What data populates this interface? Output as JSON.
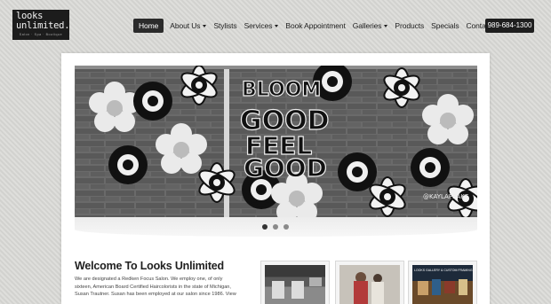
{
  "header": {
    "logo_line1": "looks",
    "logo_line2": "unlimited.",
    "logo_tagline": "Salon · Spa · Boutique",
    "phone": "989-684-1300"
  },
  "nav": {
    "items": [
      {
        "label": "Home",
        "active": true,
        "dropdown": false
      },
      {
        "label": "About Us",
        "active": false,
        "dropdown": true
      },
      {
        "label": "Stylists",
        "active": false,
        "dropdown": false
      },
      {
        "label": "Services",
        "active": false,
        "dropdown": true
      },
      {
        "label": "Book Appointment",
        "active": false,
        "dropdown": false
      },
      {
        "label": "Galleries",
        "active": false,
        "dropdown": true
      },
      {
        "label": "Products",
        "active": false,
        "dropdown": false
      },
      {
        "label": "Specials",
        "active": false,
        "dropdown": false
      },
      {
        "label": "Contact Us",
        "active": false,
        "dropdown": false
      }
    ]
  },
  "slider": {
    "mural_line1": "BLOOM",
    "mural_line2": "GOOD",
    "mural_line3": "FEEL",
    "mural_line4": "GOOD",
    "watermark": "@KAYLAPEAKE",
    "dot_count": 3,
    "active_index": 0
  },
  "welcome": {
    "title": "Welcome To Looks Unlimited",
    "lines": [
      "We are designated a Redken Focus Salon. We employ one, of only",
      "sixteen, American Board Certified Haircolorists in the state of Michigan,",
      "Susan Trautner. Susan has been employed at our salon since 1986. View"
    ]
  },
  "thumbnails": {
    "third_caption": "LOOKS GALLERY & CUSTOM FRAMING"
  },
  "colors": {
    "page_bg": "#d9d9d6",
    "nav_active_bg": "#2b2b2b",
    "phone_bg": "#1e1e1e"
  }
}
